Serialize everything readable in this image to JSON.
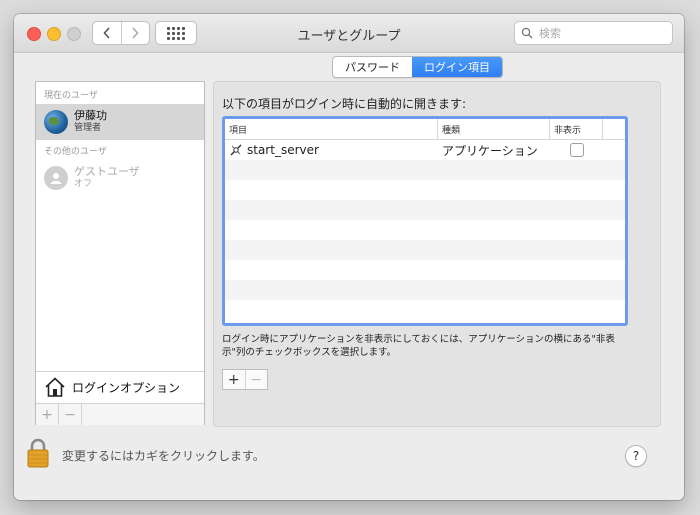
{
  "window": {
    "title": "ユーザとグループ"
  },
  "search": {
    "placeholder": "検索"
  },
  "sidebar": {
    "current_section": "現在のユーザ",
    "current_user": {
      "name": "伊藤功",
      "role": "管理者"
    },
    "other_section": "その他のユーザ",
    "guest_user": {
      "name": "ゲストユーザ",
      "status": "オフ"
    },
    "login_options": "ログインオプション",
    "add_symbol": "+",
    "remove_symbol": "−"
  },
  "tabs": [
    {
      "label": "パスワード",
      "active": false
    },
    {
      "label": "ログイン項目",
      "active": true
    }
  ],
  "panel": {
    "heading": "以下の項目がログイン時に自動的に開きます:",
    "columns": [
      "項目",
      "種類",
      "非表示"
    ],
    "rows": [
      {
        "item": "start_server",
        "kind": "アプリケーション",
        "hidden": false
      }
    ],
    "hint": "ログイン時にアプリケーションを非表示にしておくには、アプリケーションの横にある\"非表示\"列のチェックボックスを選択します。",
    "add_symbol": "+",
    "remove_symbol": "−"
  },
  "footer": {
    "lock_text": "変更するにはカギをクリックします。",
    "help_symbol": "?"
  },
  "colors": {
    "accent": "#2f7ef2",
    "table_focus": "#6b9bea",
    "close": "#fc5f57",
    "minimize": "#fdbd2e"
  },
  "icons": [
    "back-icon",
    "forward-icon",
    "grid-icon",
    "search-icon",
    "globe-avatar-icon",
    "guest-avatar-icon",
    "house-icon",
    "app-script-icon",
    "lock-icon",
    "help-icon"
  ]
}
